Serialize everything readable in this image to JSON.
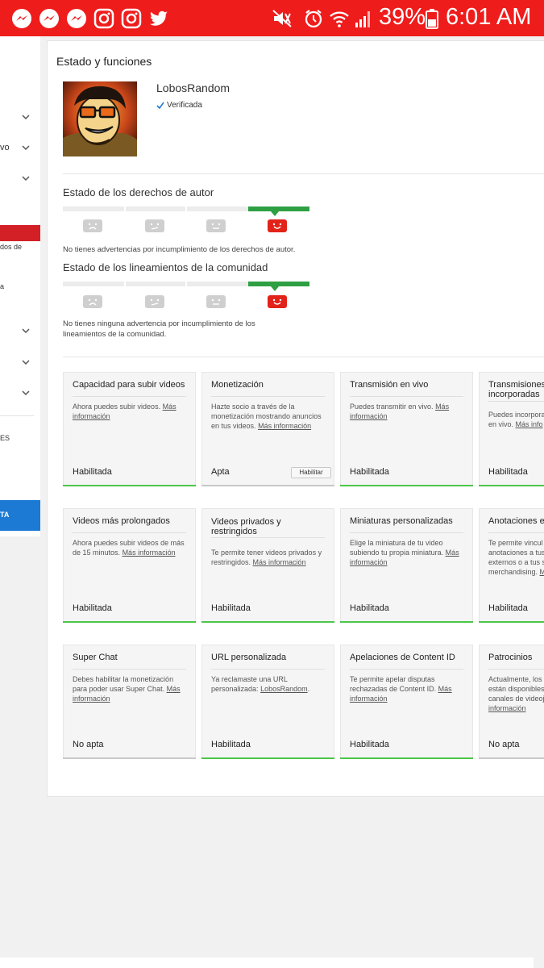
{
  "status_bar": {
    "battery": "39%",
    "time": "6:01 AM",
    "icons": [
      "messenger-icon",
      "messenger-icon",
      "messenger-icon",
      "instagram-icon",
      "instagram-icon",
      "twitter-icon",
      "mute-icon",
      "alarm-icon",
      "wifi-icon",
      "signal-icon",
      "battery-icon"
    ],
    "color": "#ef1c1c"
  },
  "sidebar": {
    "fragments": [
      "vo",
      "dos de",
      "a",
      "ES",
      "TA"
    ],
    "active_color": "#d32027",
    "button_color": "#1c7ad5"
  },
  "main": {
    "title": "Estado y funciones",
    "channel": {
      "name": "LobosRandom",
      "verified": "Verificada"
    },
    "copyright": {
      "title": "Estado de los derechos de autor",
      "note": "No tienes advertencias por incumplimiento de los derechos de autor.",
      "level": 0
    },
    "community": {
      "title": "Estado de los lineamientos de la comunidad",
      "note": "No tienes ninguna advertencia por incumplimiento de los lineamientos de la comunidad.",
      "level": 0
    },
    "features": [
      {
        "title": "Capacidad para subir videos",
        "desc": "Ahora puedes subir videos.",
        "link": "Más información",
        "status": "Habilitada",
        "bar": "green"
      },
      {
        "title": "Monetización",
        "desc": "Hazte socio a través de la monetización mostrando anuncios en tus videos.",
        "link": "Más información",
        "status": "Apta",
        "bar": "gray",
        "button": "Habilitar"
      },
      {
        "title": "Transmisión en vivo",
        "desc": "Puedes transmitir en vivo.",
        "link": "Más información",
        "status": "Habilitada",
        "bar": "green"
      },
      {
        "title": "Transmisiones incorporadas",
        "desc": "Puedes incorporar en vivo.",
        "link": "Más info",
        "status": "Habilitada",
        "bar": "green"
      },
      {
        "title": "Videos más prolongados",
        "desc": "Ahora puedes subir videos de más de 15 minutos.",
        "link": "Más información",
        "status": "Habilitada",
        "bar": "green"
      },
      {
        "title": "Videos privados y restringidos",
        "desc": "Te permite tener videos privados y restringidos.",
        "link": "Más información",
        "status": "Habilitada",
        "bar": "green"
      },
      {
        "title": "Miniaturas personalizadas",
        "desc": "Elige la miniatura de tu video subiendo tu propia miniatura.",
        "link": "Más información",
        "status": "Habilitada",
        "bar": "green"
      },
      {
        "title": "Anotaciones ex",
        "desc": "Te permite vincul anotaciones a tus externos o a tus s merchandising.",
        "link": "M",
        "status": "Habilitada",
        "bar": "green"
      },
      {
        "title": "Super Chat",
        "desc": "Debes habilitar la monetización para poder usar Super Chat.",
        "link": "Más información",
        "status": "No apta",
        "bar": "gray"
      },
      {
        "title": "URL personalizada",
        "desc": "Ya reclamaste una URL personalizada:",
        "link": "LobosRandom",
        "suffix": ".",
        "status": "Habilitada",
        "bar": "green"
      },
      {
        "title": "Apelaciones de Content ID",
        "desc": "Te permite apelar disputas rechazadas de Content ID.",
        "link": "Más información",
        "status": "Habilitada",
        "bar": "green"
      },
      {
        "title": "Patrocinios",
        "desc": "Actualmente, los están disponibles canales de videoj",
        "link": "información",
        "status": "No apta",
        "bar": "gray"
      }
    ]
  }
}
